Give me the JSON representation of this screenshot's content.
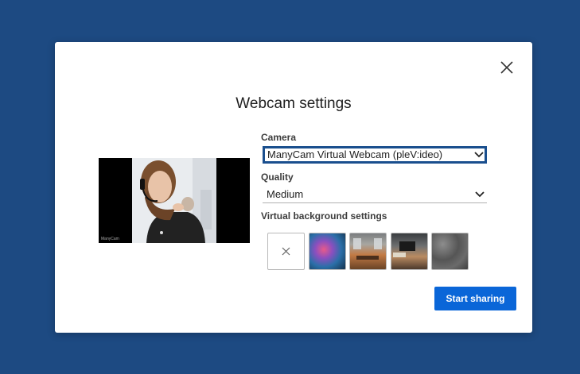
{
  "dialog": {
    "title": "Webcam settings",
    "close_icon": "close-icon"
  },
  "preview": {
    "caption": "ManyCam",
    "logo_text": "manycam"
  },
  "camera": {
    "label": "Camera",
    "value": "ManyCam Virtual Webcam (pleV:ideo)"
  },
  "quality": {
    "label": "Quality",
    "value": "Medium"
  },
  "virtual_background": {
    "label": "Virtual background settings",
    "options": [
      {
        "icon": "close-icon",
        "selected": true
      },
      {
        "icon": "image-thumbnail"
      },
      {
        "icon": "image-thumbnail"
      },
      {
        "icon": "image-thumbnail"
      },
      {
        "icon": "image-thumbnail"
      }
    ]
  },
  "actions": {
    "start_label": "Start sharing"
  },
  "colors": {
    "backdrop": "#1d4a82",
    "primary": "#0a66d8",
    "focus_border": "#1a4f8e"
  }
}
